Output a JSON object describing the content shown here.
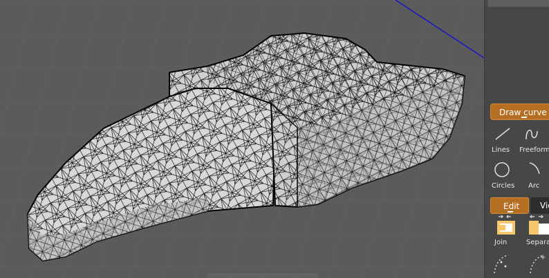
{
  "panel": {
    "draw_curve": {
      "header": "Draw curve",
      "tools": [
        {
          "label": "Lines",
          "icon": "line-icon"
        },
        {
          "label": "Freeform",
          "icon": "freeform-icon"
        },
        {
          "label": "Circles",
          "icon": "circle-icon"
        },
        {
          "label": "Arc",
          "icon": "arc-icon"
        }
      ]
    },
    "tabs": [
      {
        "label": "Edit",
        "active": true
      },
      {
        "label": "Vie",
        "active": false
      }
    ],
    "edit_tools": [
      {
        "label": "Join",
        "icon": "join-icon"
      },
      {
        "label": "Separat",
        "icon": "separate-icon"
      }
    ]
  },
  "colors": {
    "accent": "#b56f22",
    "viewport_bg": "#5b5b5b",
    "panel_bg": "#474747",
    "axis": "#1414c8"
  }
}
